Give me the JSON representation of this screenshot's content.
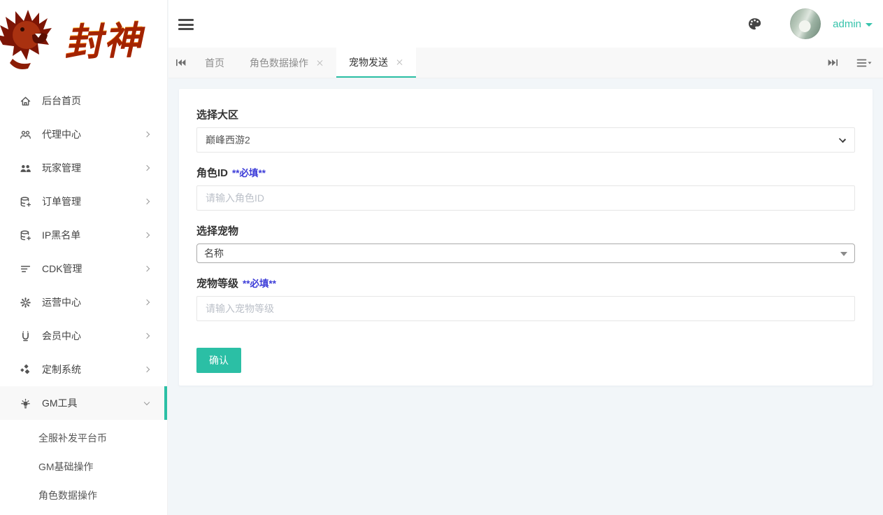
{
  "colors": {
    "accent": "#2bbfa5",
    "required_note": "#3d3dd8",
    "content_bg": "#f2f6f9",
    "logo_fire_top": "#ffe27a",
    "logo_fire_bottom": "#d82f00"
  },
  "logo": {
    "title": "封神"
  },
  "header": {
    "user": {
      "name": "admin"
    }
  },
  "tabbar": {
    "tabs": [
      {
        "label": "首页",
        "closable": false,
        "active": false
      },
      {
        "label": "角色数据操作",
        "closable": true,
        "active": false
      },
      {
        "label": "宠物发送",
        "closable": true,
        "active": true
      }
    ]
  },
  "sidebar": {
    "items": [
      {
        "label": "后台首页",
        "icon": "home-icon",
        "expandable": false
      },
      {
        "label": "代理中心",
        "icon": "agency-icon",
        "expandable": true
      },
      {
        "label": "玩家管理",
        "icon": "players-icon",
        "expandable": true
      },
      {
        "label": "订单管理",
        "icon": "orders-icon",
        "expandable": true
      },
      {
        "label": "IP黑名单",
        "icon": "ip-blacklist-icon",
        "expandable": true
      },
      {
        "label": "CDK管理",
        "icon": "cdk-icon",
        "expandable": true
      },
      {
        "label": "运营中心",
        "icon": "operations-icon",
        "expandable": true
      },
      {
        "label": "会员中心",
        "icon": "members-icon",
        "expandable": true
      },
      {
        "label": "定制系统",
        "icon": "custom-system-icon",
        "expandable": true
      },
      {
        "label": "GM工具",
        "icon": "gm-tools-icon",
        "expandable": true,
        "expanded": true,
        "active": true
      }
    ],
    "gm_submenu": [
      {
        "label": "全服补发平台币"
      },
      {
        "label": "GM基础操作"
      },
      {
        "label": "角色数据操作"
      }
    ]
  },
  "form": {
    "fields": [
      {
        "label": "选择大区",
        "type": "select",
        "value": "巅峰西游2"
      },
      {
        "label": "角色ID",
        "required_note": "**必填**",
        "type": "input",
        "placeholder": "请输入角色ID",
        "value": ""
      },
      {
        "label": "选择宠物",
        "type": "dropdown",
        "value": "名称"
      },
      {
        "label": "宠物等级",
        "required_note": "**必填**",
        "type": "input",
        "placeholder": "请输入宠物等级",
        "value": ""
      }
    ],
    "submit_label": "确认"
  }
}
